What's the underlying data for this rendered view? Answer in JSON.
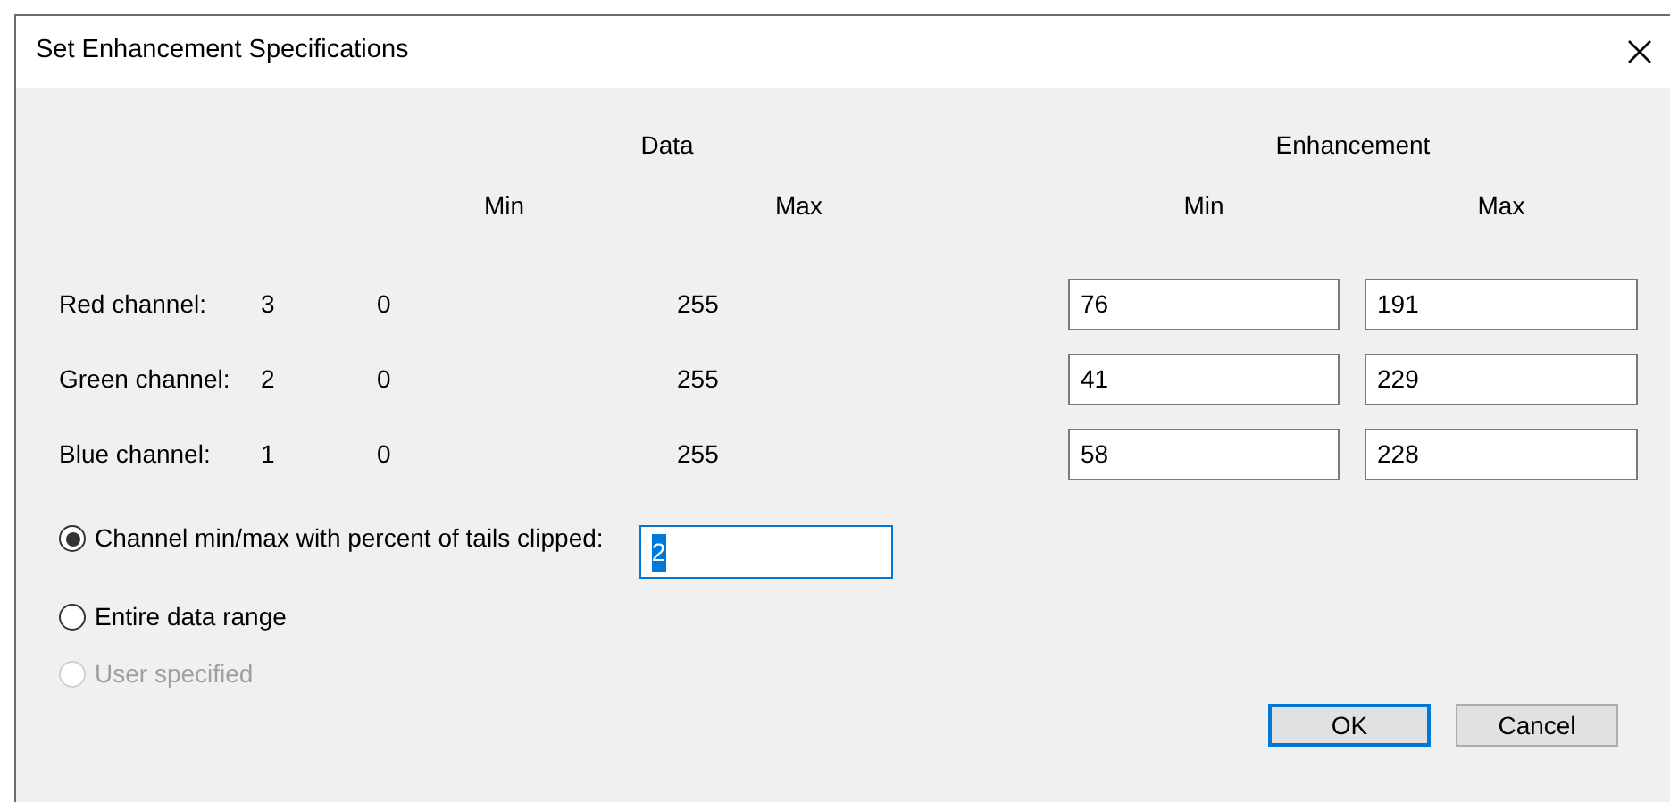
{
  "window": {
    "title": "Set Enhancement Specifications"
  },
  "headers": {
    "data": "Data",
    "enhancement": "Enhancement",
    "data_min": "Min",
    "data_max": "Max",
    "enh_min": "Min",
    "enh_max": "Max"
  },
  "channels": [
    {
      "name": "Red channel:",
      "band": "3",
      "data_min": "0",
      "data_max": "255",
      "enh_min": "76",
      "enh_max": "191"
    },
    {
      "name": "Green channel:",
      "band": "2",
      "data_min": "0",
      "data_max": "255",
      "enh_min": "41",
      "enh_max": "229"
    },
    {
      "name": "Blue channel:",
      "band": "1",
      "data_min": "0",
      "data_max": "255",
      "enh_min": "58",
      "enh_max": "228"
    }
  ],
  "options": [
    {
      "label": "Channel min/max with percent of tails clipped:",
      "selected": true,
      "disabled": false,
      "field": {
        "value": "2",
        "highlighted": true
      }
    },
    {
      "label": "Entire data range",
      "selected": false,
      "disabled": false
    },
    {
      "label": "User specified",
      "selected": false,
      "disabled": true
    }
  ],
  "buttons": [
    {
      "label": "OK",
      "default": true
    },
    {
      "label": "Cancel",
      "default": false
    }
  ]
}
